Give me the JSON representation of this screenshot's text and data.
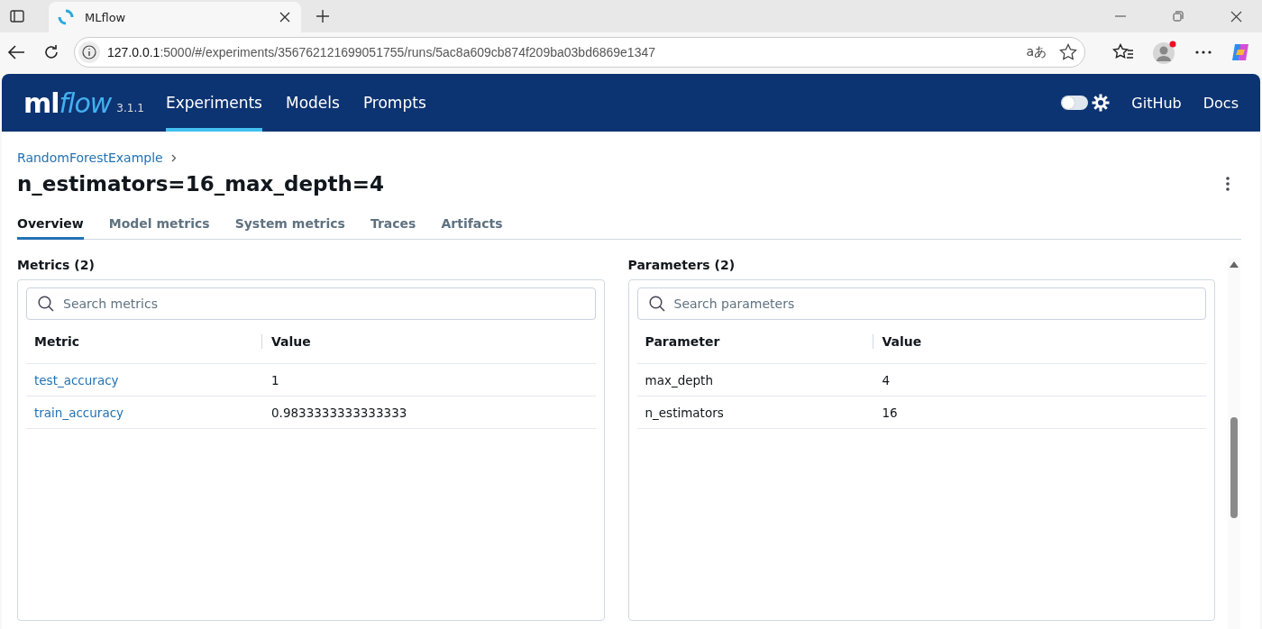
{
  "browser": {
    "tab_title": "MLflow",
    "url_host": "127.0.0.1",
    "url_rest": ":5000/#/experiments/356762121699051755/runs/5ac8a609cb874f209ba03bd6869e1347",
    "translate_glyph": "aあ"
  },
  "header": {
    "logo": {
      "main": "ml",
      "accent": "flow"
    },
    "version": "3.1.1",
    "nav": [
      {
        "label": "Experiments",
        "selected": true
      },
      {
        "label": "Models",
        "selected": false
      },
      {
        "label": "Prompts",
        "selected": false
      }
    ],
    "theme_toggle": {
      "on": false
    },
    "links": [
      "GitHub",
      "Docs"
    ]
  },
  "breadcrumb": [
    "RandomForestExample"
  ],
  "run_title": "n_estimators=16_max_depth=4",
  "tabs": [
    {
      "label": "Overview",
      "selected": true
    },
    {
      "label": "Model metrics",
      "selected": false
    },
    {
      "label": "System metrics",
      "selected": false
    },
    {
      "label": "Traces",
      "selected": false
    },
    {
      "label": "Artifacts",
      "selected": false
    }
  ],
  "metrics": {
    "title": "Metrics (2)",
    "search": {
      "placeholder": "Search metrics"
    },
    "columns": [
      "Metric",
      "Value"
    ],
    "rows": [
      {
        "name": "test_accuracy",
        "value": "1"
      },
      {
        "name": "train_accuracy",
        "value": "0.9833333333333333"
      }
    ]
  },
  "parameters": {
    "title": "Parameters (2)",
    "search": {
      "placeholder": "Search parameters"
    },
    "columns": [
      "Parameter",
      "Value"
    ],
    "rows": [
      {
        "name": "max_depth",
        "value": "4"
      },
      {
        "name": "n_estimators",
        "value": "16"
      }
    ]
  }
}
